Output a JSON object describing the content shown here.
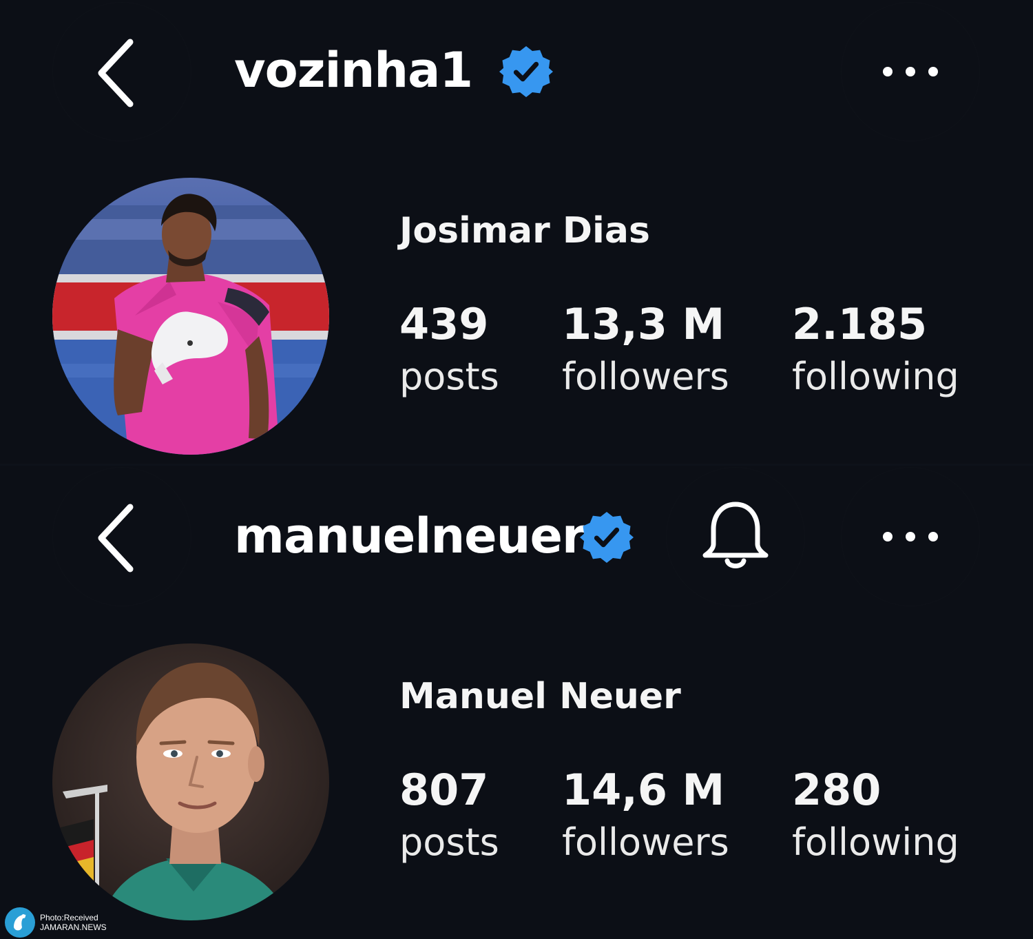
{
  "profiles": [
    {
      "username": "vozinha1",
      "verified": true,
      "full_name": "Josimar Dias",
      "stats": [
        {
          "value": "439",
          "label": "posts"
        },
        {
          "value": "13,3 M",
          "label": "followers"
        },
        {
          "value": "2.185",
          "label": "following"
        }
      ]
    },
    {
      "username": "manuelneuer",
      "verified": true,
      "full_name": "Manuel Neuer",
      "stats": [
        {
          "value": "807",
          "label": "posts"
        },
        {
          "value": "14,6 M",
          "label": "followers"
        },
        {
          "value": "280",
          "label": "following"
        }
      ]
    }
  ],
  "icons": {
    "back": "chevron-left-icon",
    "more": "more-horizontal-icon",
    "verified": "verified-badge-icon",
    "notifications": "bell-icon"
  },
  "colors": {
    "background": "#0c0f16",
    "verified_blue": "#3797f0",
    "text": "#ffffff"
  },
  "watermark": {
    "line1": "Photo:Received",
    "line2": "JAMARAN.NEWS"
  }
}
